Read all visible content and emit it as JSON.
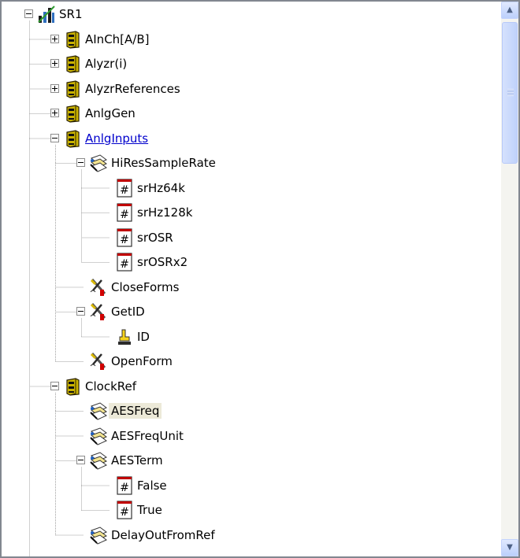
{
  "tree": {
    "nodes": [
      {
        "label": "SR1",
        "icon": "instrument-icon",
        "expander": "minus",
        "level": 0
      },
      {
        "label": "AInCh[A/B]",
        "icon": "object-icon",
        "expander": "plus",
        "level": 1
      },
      {
        "label": "Alyzr(i)",
        "icon": "object-icon",
        "expander": "plus",
        "level": 1
      },
      {
        "label": "AlyzrReferences",
        "icon": "object-icon",
        "expander": "plus",
        "level": 1
      },
      {
        "label": "AnlgGen",
        "icon": "object-icon",
        "expander": "plus",
        "level": 1
      },
      {
        "label": "AnlgInputs",
        "icon": "object-icon",
        "expander": "minus",
        "level": 1,
        "style": "link"
      },
      {
        "label": "HiResSampleRate",
        "icon": "property-icon",
        "expander": "minus",
        "level": 2
      },
      {
        "label": "srHz64k",
        "icon": "constant-icon",
        "level": 3
      },
      {
        "label": "srHz128k",
        "icon": "constant-icon",
        "level": 3
      },
      {
        "label": "srOSR",
        "icon": "constant-icon",
        "level": 3
      },
      {
        "label": "srOSRx2",
        "icon": "constant-icon",
        "level": 3
      },
      {
        "label": "CloseForms",
        "icon": "method-icon",
        "level": 2
      },
      {
        "label": "GetID",
        "icon": "method-icon",
        "expander": "minus",
        "level": 2
      },
      {
        "label": "ID",
        "icon": "parameter-icon",
        "level": 3
      },
      {
        "label": "OpenForm",
        "icon": "method-icon",
        "level": 2
      },
      {
        "label": "ClockRef",
        "icon": "object-icon",
        "expander": "minus",
        "level": 1
      },
      {
        "label": "AESFreq",
        "icon": "property-icon",
        "level": 2,
        "style": "selected"
      },
      {
        "label": "AESFreqUnit",
        "icon": "property-icon",
        "level": 2
      },
      {
        "label": "AESTerm",
        "icon": "property-icon",
        "expander": "minus",
        "level": 2
      },
      {
        "label": "False",
        "icon": "constant-icon",
        "level": 3
      },
      {
        "label": "True",
        "icon": "constant-icon",
        "level": 3
      },
      {
        "label": "DelayOutFromRef",
        "icon": "property-icon",
        "level": 2
      }
    ]
  },
  "scrollbar": {
    "up_icon": "chevron-up-icon",
    "down_icon": "chevron-down-icon",
    "position": 0.0
  },
  "colors": {
    "link": "#0000cc",
    "selection": "#ece9d8",
    "tree_line": "#a0a0a0"
  }
}
